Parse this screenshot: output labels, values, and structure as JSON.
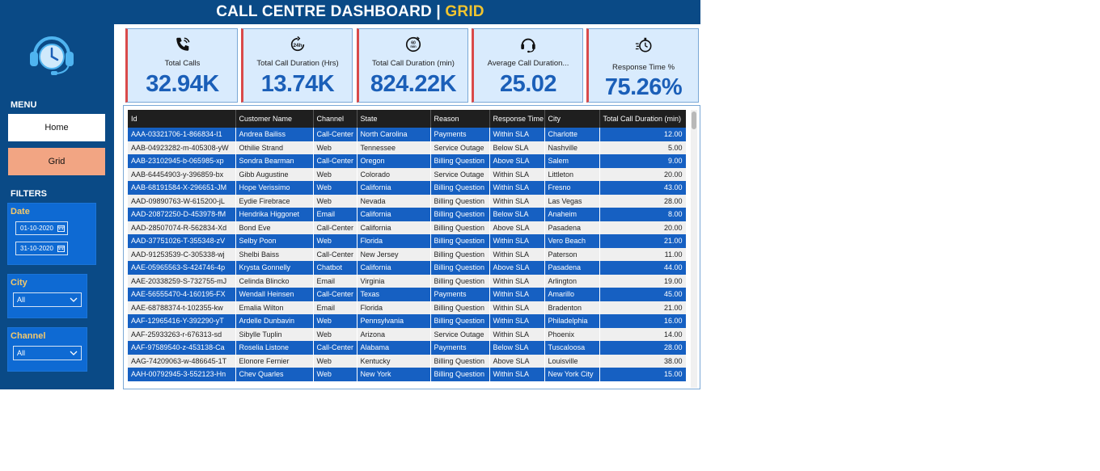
{
  "header": {
    "title_main": "CALL CENTRE DASHBOARD | ",
    "title_accent": "GRID"
  },
  "sidebar": {
    "menu_label": "MENU",
    "nav": {
      "home": "Home",
      "grid": "Grid"
    },
    "filters_label": "FILTERS",
    "date_filter": {
      "title": "Date",
      "from": "01-10-2020",
      "to": "31-10-2020"
    },
    "city_filter": {
      "title": "City",
      "value": "All"
    },
    "channel_filter": {
      "title": "Channel",
      "value": "All"
    }
  },
  "kpis": [
    {
      "label": "Total Calls",
      "value": "32.94K",
      "icon": "phone-ringing-icon"
    },
    {
      "label": "Total Call Duration (Hrs)",
      "value": "13.74K",
      "icon": "clock-24h-icon"
    },
    {
      "label": "Total Call Duration (min)",
      "value": "824.22K",
      "icon": "clock-60min-icon"
    },
    {
      "label": "Average Call Duration...",
      "value": "25.02",
      "icon": "headset-icon"
    },
    {
      "label": "Response Time %",
      "value": "75.26%",
      "icon": "stopwatch-icon"
    }
  ],
  "table": {
    "columns": [
      "Id",
      "Customer Name",
      "Channel",
      "State",
      "Reason",
      "Response Time",
      "City",
      "Total Call Duration (min)"
    ],
    "rows": [
      [
        "AAA-03321706-1-866834-I1",
        "Andrea Bailiss",
        "Call-Center",
        "North Carolina",
        "Payments",
        "Within SLA",
        "Charlotte",
        "12.00"
      ],
      [
        "AAB-04923282-m-405308-yW",
        "Othilie Strand",
        "Web",
        "Tennessee",
        "Service Outage",
        "Below SLA",
        "Nashville",
        "5.00"
      ],
      [
        "AAB-23102945-b-065985-xp",
        "Sondra Bearman",
        "Call-Center",
        "Oregon",
        "Billing Question",
        "Above SLA",
        "Salem",
        "9.00"
      ],
      [
        "AAB-64454903-y-396859-bx",
        "Gibb Augustine",
        "Web",
        "Colorado",
        "Service Outage",
        "Within SLA",
        "Littleton",
        "20.00"
      ],
      [
        "AAB-68191584-X-296651-JM",
        "Hope Verissimo",
        "Web",
        "California",
        "Billing Question",
        "Within SLA",
        "Fresno",
        "43.00"
      ],
      [
        "AAD-09890763-W-615200-jL",
        "Eydie Firebrace",
        "Web",
        "Nevada",
        "Billing Question",
        "Within SLA",
        "Las Vegas",
        "28.00"
      ],
      [
        "AAD-20872250-D-453978-fM",
        "Hendrika Higgonet",
        "Email",
        "California",
        "Billing Question",
        "Below SLA",
        "Anaheim",
        "8.00"
      ],
      [
        "AAD-28507074-R-562834-Xd",
        "Bond Eve",
        "Call-Center",
        "California",
        "Billing Question",
        "Above SLA",
        "Pasadena",
        "20.00"
      ],
      [
        "AAD-37751026-T-355348-zV",
        "Selby Poon",
        "Web",
        "Florida",
        "Billing Question",
        "Within SLA",
        "Vero Beach",
        "21.00"
      ],
      [
        "AAD-91253539-C-305338-wj",
        "Shelbi Baiss",
        "Call-Center",
        "New Jersey",
        "Billing Question",
        "Within SLA",
        "Paterson",
        "11.00"
      ],
      [
        "AAE-05965563-S-424746-4p",
        "Krysta Gonnelly",
        "Chatbot",
        "California",
        "Billing Question",
        "Above SLA",
        "Pasadena",
        "44.00"
      ],
      [
        "AAE-20338259-S-732755-mJ",
        "Celinda Blincko",
        "Email",
        "Virginia",
        "Billing Question",
        "Within SLA",
        "Arlington",
        "19.00"
      ],
      [
        "AAE-56555470-4-160195-FX",
        "Wendall Heinsen",
        "Call-Center",
        "Texas",
        "Payments",
        "Within SLA",
        "Amarillo",
        "45.00"
      ],
      [
        "AAE-68788374-t-102355-kw",
        "Emalia Wilton",
        "Email",
        "Florida",
        "Billing Question",
        "Within SLA",
        "Bradenton",
        "21.00"
      ],
      [
        "AAF-12965416-Y-392290-yT",
        "Ardelle Dunbavin",
        "Web",
        "Pennsylvania",
        "Billing Question",
        "Within SLA",
        "Philadelphia",
        "16.00"
      ],
      [
        "AAF-25933263-r-676313-sd",
        "Sibylle Tuplin",
        "Web",
        "Arizona",
        "Service Outage",
        "Within SLA",
        "Phoenix",
        "14.00"
      ],
      [
        "AAF-97589540-z-453138-Ca",
        "Roselia Listone",
        "Call-Center",
        "Alabama",
        "Payments",
        "Below SLA",
        "Tuscaloosa",
        "28.00"
      ],
      [
        "AAG-74209063-w-486645-1T",
        "Elonore Fernier",
        "Web",
        "Kentucky",
        "Billing Question",
        "Above SLA",
        "Louisville",
        "38.00"
      ],
      [
        "AAH-00792945-3-552123-Hn",
        "Chev Quarles",
        "Web",
        "New York",
        "Billing Question",
        "Within SLA",
        "New York City",
        "15.00"
      ]
    ]
  },
  "colors": {
    "background": "#0a4a86",
    "accent": "#f0c430",
    "kpi_value": "#1b5fb8",
    "row_highlight": "#1660c2",
    "grid_button": "#f2a583"
  }
}
